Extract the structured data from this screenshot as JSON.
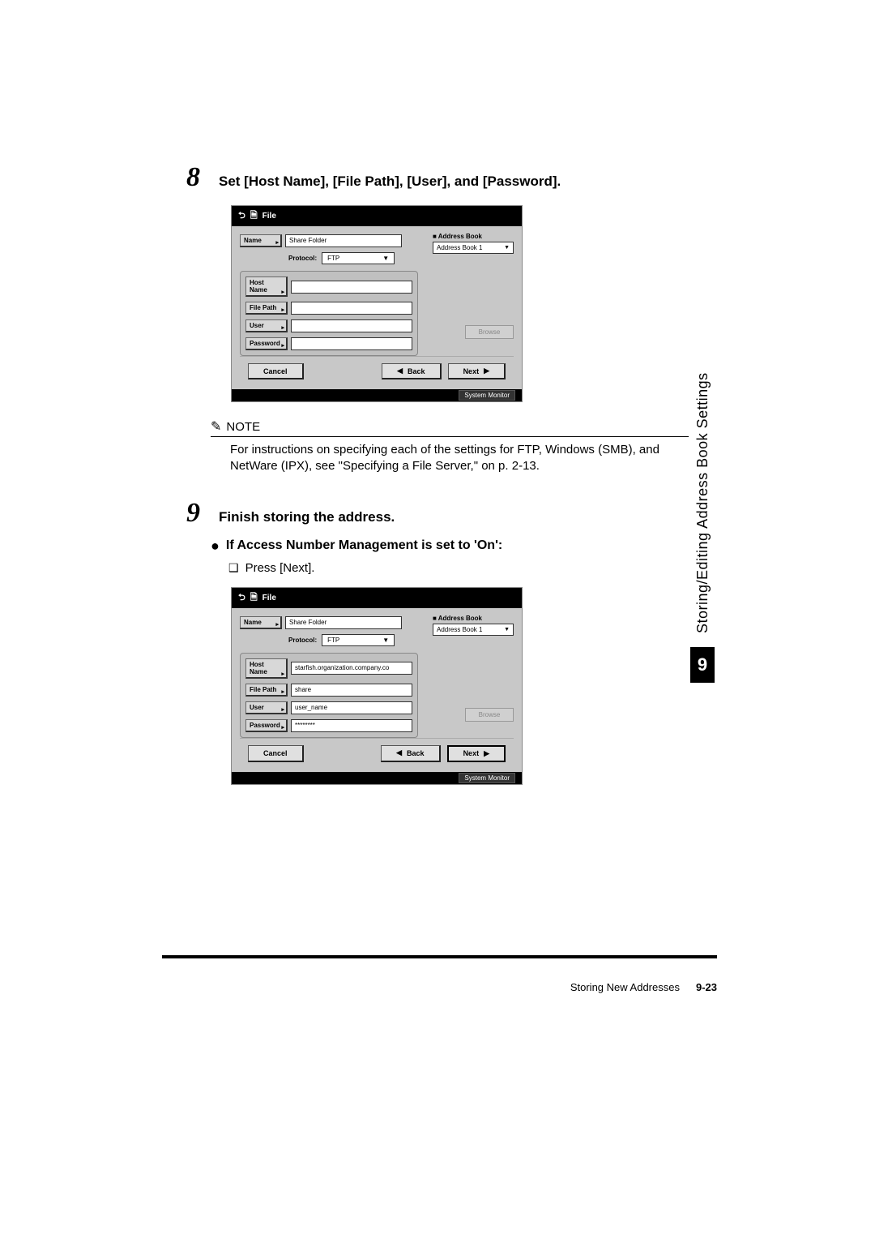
{
  "step8": {
    "num": "8",
    "title": "Set [Host Name], [File Path], [User], and [Password]."
  },
  "screen1": {
    "titlebar": "File",
    "name_label": "Name",
    "name_value": "Share Folder",
    "addr_label": "■ Address Book",
    "addr_value": "Address Book 1",
    "protocol_label": "Protocol:",
    "protocol_value": "FTP",
    "host_label": "Host Name",
    "host_value": "",
    "path_label": "File Path",
    "path_value": "",
    "user_label": "User",
    "user_value": "",
    "pwd_label": "Password",
    "pwd_value": "",
    "browse": "Browse",
    "cancel": "Cancel",
    "back": "Back",
    "next": "Next",
    "status": "System Monitor"
  },
  "note": {
    "label": "NOTE",
    "text": "For instructions on specifying each of the settings for FTP, Windows (SMB), and NetWare (IPX), see \"Specifying a File Server,\" on p. 2-13."
  },
  "step9": {
    "num": "9",
    "title": "Finish storing the address."
  },
  "sub": {
    "bullet": "If Access Number Management is set to 'On':",
    "press": "Press [Next]."
  },
  "screen2": {
    "titlebar": "File",
    "name_label": "Name",
    "name_value": "Share Folder",
    "addr_label": "■ Address Book",
    "addr_value": "Address Book 1",
    "protocol_label": "Protocol:",
    "protocol_value": "FTP",
    "host_label": "Host Name",
    "host_value": "starfish.organization.company.co",
    "path_label": "File Path",
    "path_value": "share",
    "user_label": "User",
    "user_value": "user_name",
    "pwd_label": "Password",
    "pwd_value": "********",
    "browse": "Browse",
    "cancel": "Cancel",
    "back": "Back",
    "next": "Next",
    "status": "System Monitor"
  },
  "side": {
    "text": "Storing/Editing Address Book Settings",
    "num": "9"
  },
  "footer": {
    "section": "Storing New Addresses",
    "page": "9-23"
  }
}
